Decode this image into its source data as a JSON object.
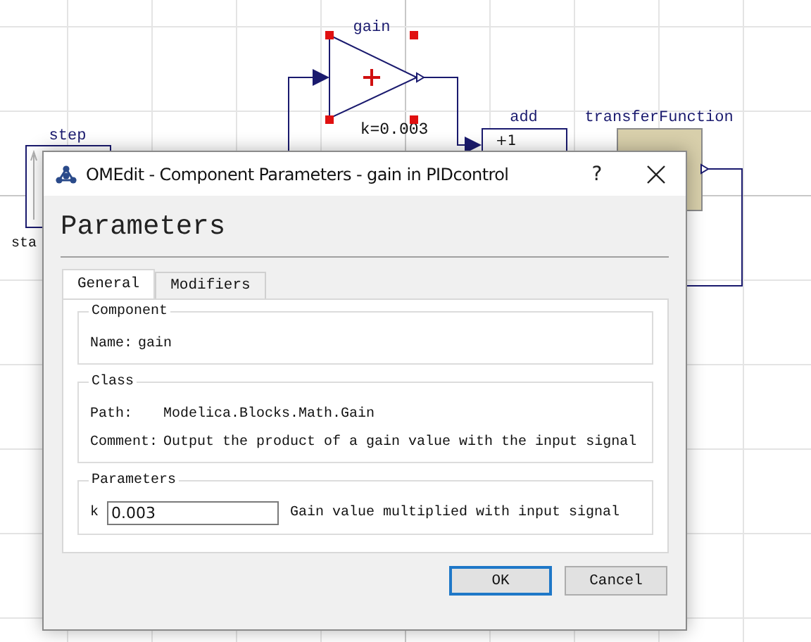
{
  "diagram": {
    "blocks": [
      {
        "kind": "gain",
        "label": "gain",
        "parameter": "k=0.003",
        "selected": true
      },
      {
        "kind": "add",
        "label": "add",
        "sign": "+1",
        "selected": false
      },
      {
        "kind": "transfer",
        "label": "transferFunction",
        "selected": false
      },
      {
        "kind": "step",
        "label": "step",
        "caption": "sta",
        "selected": false
      }
    ]
  },
  "dialog": {
    "title": "OMEdit - Component Parameters - gain in PIDcontrol",
    "help": "?",
    "heading": "Parameters",
    "tabs": [
      {
        "label": "General",
        "selected": true
      },
      {
        "label": "Modifiers",
        "selected": false
      }
    ],
    "groups": [
      {
        "title": "Component",
        "rows": [
          {
            "label": "Name:",
            "value": "gain"
          }
        ]
      },
      {
        "title": "Class",
        "rows": [
          {
            "label": "Path:",
            "value": "Modelica.Blocks.Math.Gain"
          },
          {
            "label": "Comment:",
            "value": "Output the product of a gain value with the input signal"
          }
        ]
      }
    ],
    "parameters": {
      "title": "Parameters",
      "items": [
        {
          "name": "k",
          "value": "0.003",
          "description": "Gain value multiplied with input signal"
        }
      ]
    },
    "buttons": [
      {
        "label": "OK",
        "default": true
      },
      {
        "label": "Cancel",
        "default": false
      }
    ]
  }
}
